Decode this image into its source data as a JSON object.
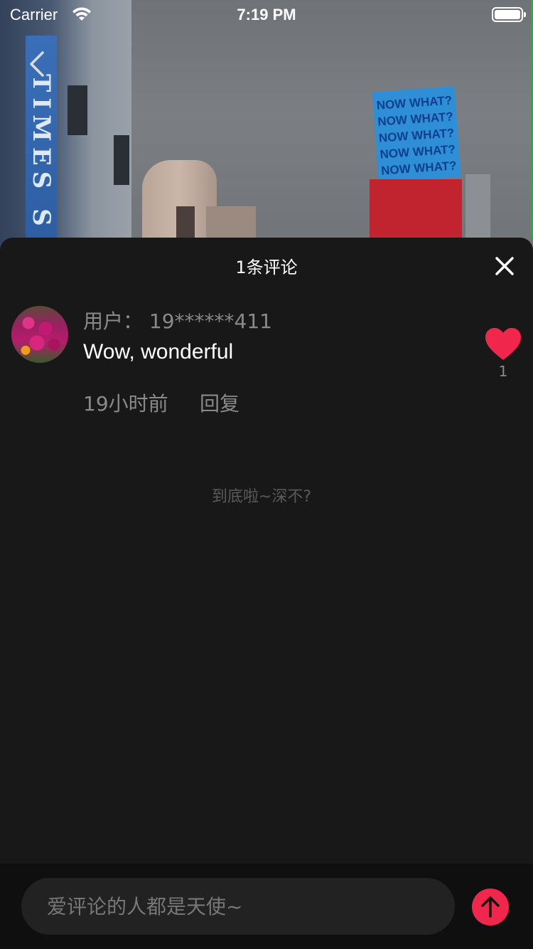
{
  "status_bar": {
    "carrier": "Carrier",
    "time": "7:19 PM"
  },
  "video": {
    "sign_text": "TIMES S",
    "billboard_blue": [
      "NOW WHAT?",
      "NOW WHAT?",
      "NOW WHAT?",
      "NOW WHAT?",
      "NOW WHAT?"
    ]
  },
  "sheet": {
    "title": "1条评论",
    "comments": [
      {
        "user": "用户： 19******411",
        "text": "Wow, wonderful",
        "time": "19小时前",
        "reply_label": "回复",
        "likes": "1"
      }
    ],
    "end_hint": "到底啦~深不?"
  },
  "input": {
    "placeholder": "爱评论的人都是天使~"
  },
  "colors": {
    "accent": "#f0264c",
    "sheet_bg": "#181818",
    "muted_text": "#8a8a8a"
  }
}
